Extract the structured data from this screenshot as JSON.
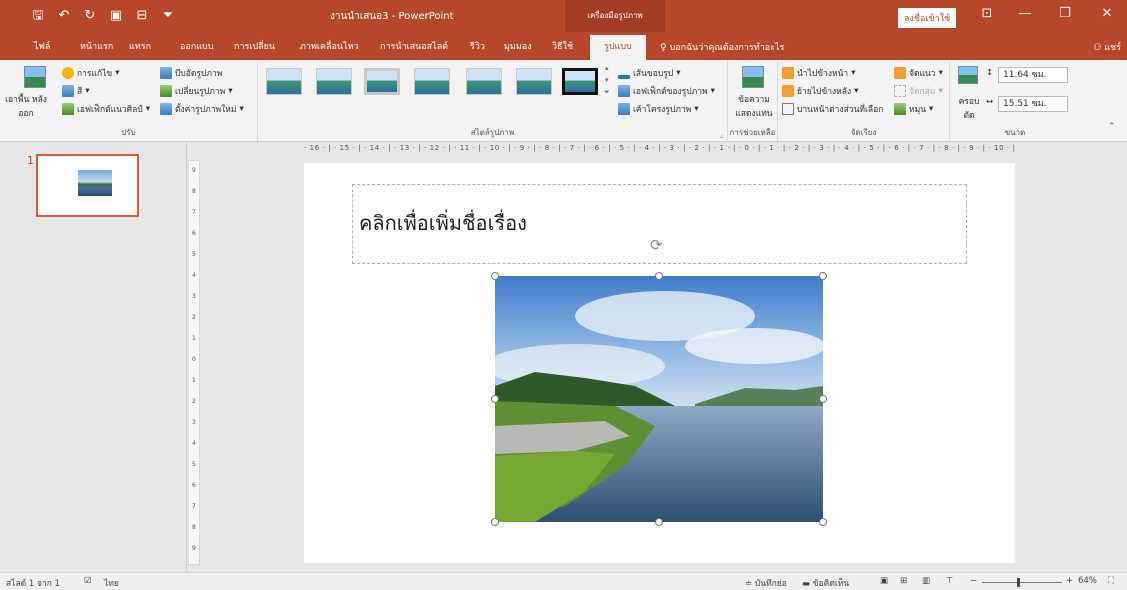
{
  "window": {
    "title": "งานนำเสนอ3  -  PowerPoint",
    "context_tab": "เครื่องมือรูปภาพ",
    "signin": "ลงชื่อเข้าใช้",
    "share": "แชร์",
    "tell_me": "บอกฉันว่าคุณต้องการทำอะไร"
  },
  "tabs": [
    {
      "label": "ไฟล์"
    },
    {
      "label": "หน้าแรก"
    },
    {
      "label": "แทรก"
    },
    {
      "label": "ออกแบบ"
    },
    {
      "label": "การเปลี่ยน"
    },
    {
      "label": "ภาพเคลื่อนไหว"
    },
    {
      "label": "การนำเสนอสไลด์"
    },
    {
      "label": "รีวิว"
    },
    {
      "label": "มุมมอง"
    },
    {
      "label": "วิธีใช้"
    },
    {
      "label": "รูปแบบ"
    }
  ],
  "ribbon": {
    "adjust": {
      "remove_bg": "เอาพื้น หลังออก",
      "corrections": "การแก้ไข",
      "color": "สี",
      "artistic": "เอฟเฟ็กต์แนวศิลป์",
      "compress": "บีบอัดรูปภาพ",
      "change": "เปลี่ยนรูปภาพ",
      "reset": "ตั้งค่ารูปภาพใหม่",
      "label": "ปรับ"
    },
    "styles": {
      "label": "สไตล์รูปภาพ",
      "border": "เส้นขอบรูป",
      "effects": "เอฟเฟ็กต์ของรูปภาพ",
      "layout": "เค้าโครงรูปภาพ"
    },
    "access": {
      "alt": "ข้อความ แสดงแทน",
      "label": "การช่วยเหลือ"
    },
    "arrange": {
      "forward": "นำไปข้างหน้า",
      "backward": "ย้ายไปข้างหลัง",
      "pane": "บานหน้าต่างส่วนที่เลือก",
      "align": "จัดแนว",
      "group": "จัดกลุ่ม",
      "rotate": "หมุน",
      "label": "จัดเรียง"
    },
    "size": {
      "crop": "ครอบ ตัด",
      "height": "11.64 ซม.",
      "width": "15.51 ซม.",
      "label": "ขนาด"
    }
  },
  "slide": {
    "number": "1",
    "title_placeholder": "คลิกเพื่อเพิ่มชื่อเรื่อง"
  },
  "ruler_h": "· 16 · | · 15 · | · 14 · | · 13 · | · 12 · | · 11 · | · 10 · | · 9 · | · 8 · | · 7 · | · 6 · | · 5 · | · 4 · | · 3 · | · 2 · | · 1 · | · 0 · | · 1 · | · 2 · | · 3 · | · 4 · | · 5 · | · 6 · | · 7 · | · 8 · | · 9 · | · 10 · | · 11 · | · 12 · | · 13 · | · 14 · | · 15 · | · 16 ·",
  "ruler_v": [
    "9",
    "8",
    "7",
    "6",
    "5",
    "4",
    "3",
    "2",
    "1",
    "0",
    "1",
    "2",
    "3",
    "4",
    "5",
    "6",
    "7",
    "8",
    "9"
  ],
  "status": {
    "slide_of": "สไลด์ 1 จาก 1",
    "language": "ไทย",
    "notes": "บันทึกย่อ",
    "comments": "ข้อคิดเห็น",
    "zoom": "64%"
  }
}
